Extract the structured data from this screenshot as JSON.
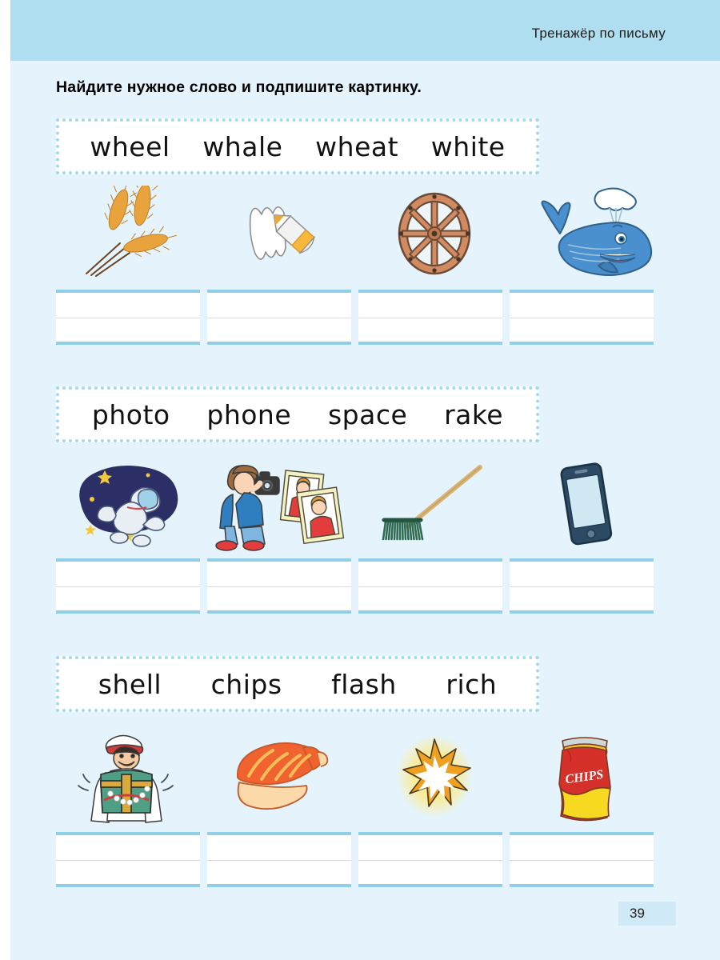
{
  "header": {
    "title": "Тренажёр по письму"
  },
  "instruction": "Найдите нужное слово и подпишите картинку.",
  "page_number": "39",
  "colors": {
    "page_bg": "#e5f4fc",
    "header_bg": "#aedeef",
    "dotted_border": "#a6d8ef",
    "line_blue": "#8fd0e8",
    "mid_line": "#bfe4f3",
    "pagenum_bg": "#cfe9f7"
  },
  "exercises": [
    {
      "words": [
        "wheel",
        "whale",
        "wheat",
        "white"
      ],
      "pictures": [
        {
          "name": "wheat-stalks-picture",
          "answer": "wheat"
        },
        {
          "name": "white-crayon-drawing-picture",
          "answer": "white"
        },
        {
          "name": "wagon-wheel-picture",
          "answer": "wheel"
        },
        {
          "name": "whale-picture",
          "answer": "whale"
        }
      ],
      "answer_lines": [
        "",
        "",
        "",
        ""
      ]
    },
    {
      "words": [
        "photo",
        "phone",
        "space",
        "rake"
      ],
      "pictures": [
        {
          "name": "astronaut-in-space-picture",
          "answer": "space"
        },
        {
          "name": "photographer-with-photos-picture",
          "answer": "photo"
        },
        {
          "name": "rake-picture",
          "answer": "rake"
        },
        {
          "name": "smartphone-picture",
          "answer": "phone"
        }
      ],
      "answer_lines": [
        "",
        "",
        "",
        ""
      ]
    },
    {
      "words": [
        "shell",
        "chips",
        "flash",
        "rich"
      ],
      "pictures": [
        {
          "name": "rich-man-with-treasure-picture",
          "answer": "rich"
        },
        {
          "name": "seashell-picture",
          "answer": "shell"
        },
        {
          "name": "flash-burst-picture",
          "answer": "flash"
        },
        {
          "name": "chips-bag-picture",
          "answer": "chips",
          "label": "CHIPS"
        }
      ],
      "answer_lines": [
        "",
        "",
        "",
        ""
      ]
    }
  ]
}
